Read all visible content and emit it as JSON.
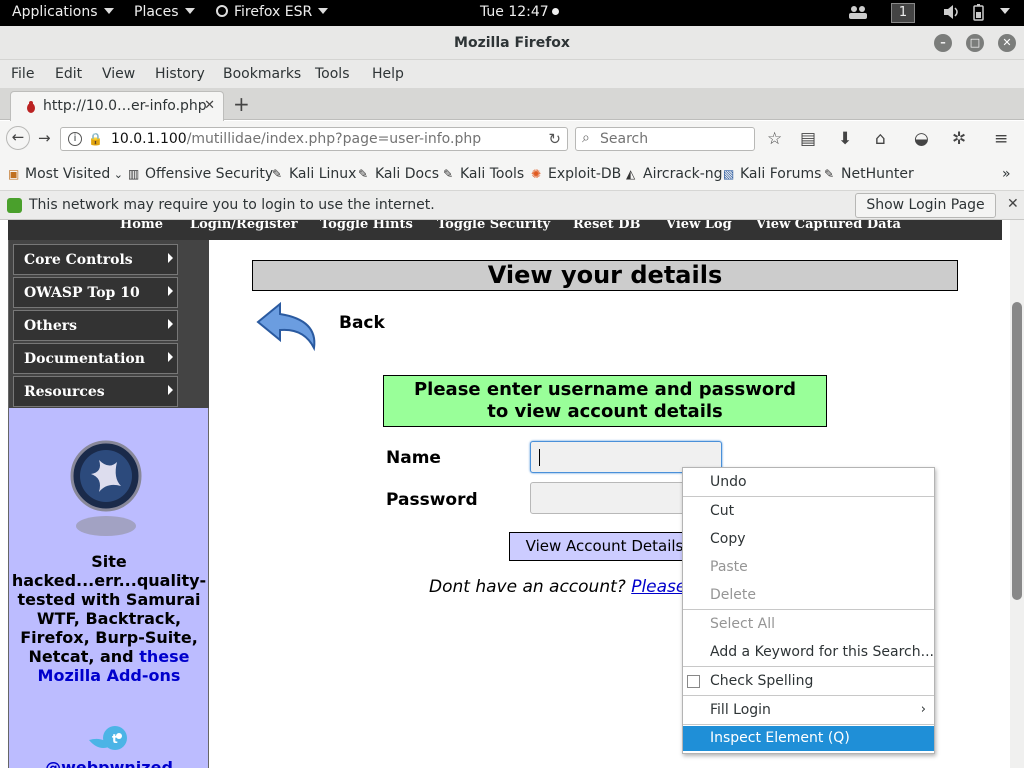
{
  "topbar": {
    "applications": "Applications",
    "places": "Places",
    "firefox_app": "Firefox ESR",
    "clock": "Tue 12:47",
    "workspace": "1"
  },
  "window": {
    "title": "Mozilla Firefox"
  },
  "menubar": {
    "file": "File",
    "edit": "Edit",
    "view": "View",
    "history": "History",
    "bookmarks": "Bookmarks",
    "tools": "Tools",
    "help": "Help"
  },
  "tab": {
    "title": "http://10.0…er-info.php",
    "close": "✕",
    "new_tab": "+"
  },
  "navbar": {
    "url_host": "10.0.1.100",
    "url_path": "/mutillidae/index.php?page=user-info.php",
    "search_placeholder": "Search"
  },
  "bookmarks": {
    "most_visited": "Most Visited",
    "items": [
      "Offensive Security",
      "Kali Linux",
      "Kali Docs",
      "Kali Tools",
      "Exploit-DB",
      "Aircrack-ng",
      "Kali Forums",
      "NetHunter"
    ],
    "overflow": "»"
  },
  "notification": {
    "text": "This network may require you to login to use the internet.",
    "button": "Show Login Page",
    "close": "✕"
  },
  "site_nav": {
    "items": [
      "Home",
      "Login/Register",
      "Toggle Hints",
      "Toggle Security",
      "Reset DB",
      "View Log",
      "View Captured Data"
    ]
  },
  "sidebar": {
    "menu": [
      "Core Controls",
      "OWASP Top 10",
      "Others",
      "Documentation",
      "Resources"
    ],
    "text_main": "Site hacked...err...quality-tested with Samurai WTF, Backtrack, Firefox, Burp-Suite, Netcat, and",
    "text_link": "these Mozilla Add-ons",
    "handle": "@webpwnized"
  },
  "main": {
    "heading": "View your details",
    "back": "Back",
    "instruction_line1": "Please enter username and password",
    "instruction_line2": "to view account details",
    "name_label": "Name",
    "password_label": "Password",
    "submit": "View Account Details",
    "no_account": "Dont have an account?",
    "register_link": "Please r"
  },
  "context_menu": {
    "undo": "Undo",
    "cut": "Cut",
    "copy": "Copy",
    "paste": "Paste",
    "delete": "Delete",
    "select_all": "Select All",
    "add_keyword": "Add a Keyword for this Search...",
    "check_spelling": "Check Spelling",
    "fill_login": "Fill Login",
    "inspect": "Inspect Element (Q)"
  },
  "colors": {
    "heading_bar": "#cccccc",
    "instruction_box": "#99ff99",
    "submit_button": "#ccccff",
    "sidebar_bg": "#bcbcff",
    "context_highlight": "#1f8fd7"
  }
}
